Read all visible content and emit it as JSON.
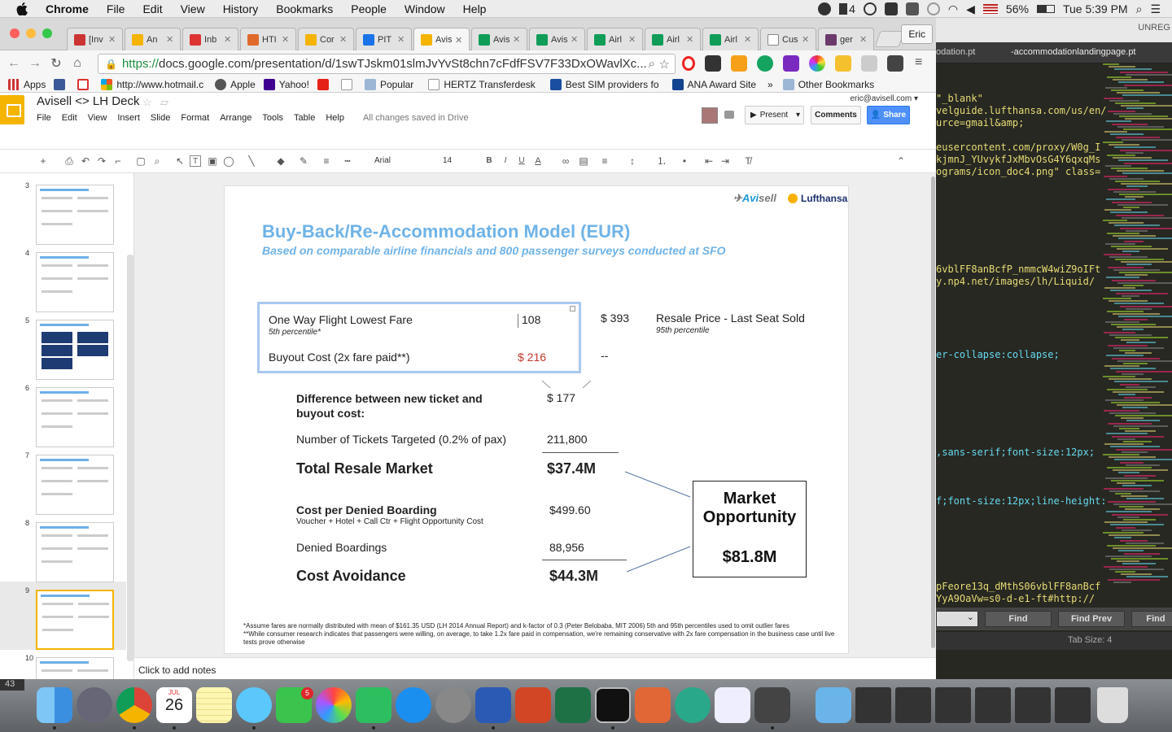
{
  "menubar": {
    "app": "Chrome",
    "items": [
      "File",
      "Edit",
      "View",
      "History",
      "Bookmarks",
      "People",
      "Window",
      "Help"
    ],
    "status_count": "4",
    "battery": "56%",
    "clock": "Tue 5:39 PM"
  },
  "browser": {
    "tabs": [
      "[Inv",
      "An",
      "Inb",
      "HTI",
      "Cor",
      "PIT",
      "Avis",
      "Avis",
      "Avis",
      "Airl",
      "Airl",
      "Airl",
      "Cus",
      "ger"
    ],
    "active_tab": 6,
    "profile": "Eric",
    "url_scheme": "https://",
    "url_rest": "docs.google.com/presentation/d/1swTJskm01slmJvYvSt8chn7cFdfFSV7F33DxOWavlXc...",
    "bookmarks": [
      "Apps",
      "http://www.hotmail.c",
      "Apple",
      "Yahoo!",
      "Popular",
      "HERTZ Transferdesk",
      "Best SIM providers fo",
      "ANA Award Site",
      "»",
      "Other Bookmarks"
    ]
  },
  "docs": {
    "title": "Avisell <> LH Deck",
    "menus": [
      "File",
      "Edit",
      "View",
      "Insert",
      "Slide",
      "Format",
      "Arrange",
      "Tools",
      "Table",
      "Help"
    ],
    "saved_status": "All changes saved in Drive",
    "email": "eric@avisell.com ▾",
    "present": "Present",
    "comments": "Comments",
    "share": "Share",
    "font": "Arial",
    "font_size": "14",
    "notes_placeholder": "Click to add notes"
  },
  "filmstrip": {
    "numbers": [
      "3",
      "4",
      "5",
      "6",
      "7",
      "8",
      "9",
      "10"
    ],
    "selected": "9"
  },
  "slide": {
    "logo_avisell_a": "Avi",
    "logo_avisell_b": "sell",
    "logo_lufthansa": "Lufthansa",
    "title": "Buy-Back/Re-Accommodation Model (EUR)",
    "subtitle": "Based on comparable airline financials and 800 passenger surveys conducted at SFO",
    "fare_label": "One Way Flight Lowest Fare",
    "fare_sub": "5th percentile*",
    "fare_value": "108",
    "buyout_label": "Buyout Cost (2x fare paid**)",
    "buyout_value": "$ 216",
    "resale_value": "$ 393",
    "resale_label": "Resale Price - Last Seat Sold",
    "resale_sub": "95th percentile",
    "dash": "--",
    "diff_label": "Difference between new ticket and buyout cost:",
    "diff_value": "$ 177",
    "tickets_label": "Number of Tickets Targeted (0.2% of pax)",
    "tickets_value": "211,800",
    "total_label": "Total Resale Market",
    "total_value": "$37.4M",
    "cpdb_label": "Cost per Denied Boarding",
    "cpdb_sub": "Voucher + Hotel + Call Ctr + Flight Opportunity Cost",
    "cpdb_value": "$499.60",
    "denied_label": "Denied Boardings",
    "denied_value": "88,956",
    "avoid_label": "Cost Avoidance",
    "avoid_value": "$44.3M",
    "market_line1": "Market",
    "market_line2": "Opportunity",
    "market_value": "$81.8M",
    "footnote1": "*Assume fares are normally distributed with mean of $161.35 USD (LH 2014 Annual Report) and k-factor of 0.3 (Peter Belobaba, MIT 2006) 5th and 95th percentiles used to omit outlier fares",
    "footnote2": "**While consumer research indicates that passengers were willing, on average, to take 1.2x fare paid in compensation, we're remaining conservative with 2x fare compensation in the business case until live tests prove otherwise"
  },
  "editor": {
    "header": "UNREG",
    "tab1": "odation.pt",
    "tab2": "-accommodationlandingpage.pt",
    "lines": [
      {
        "t": "\"_blank\"",
        "c": "#e6db74"
      },
      {
        "t": "velguide.lufthansa.com/us/en/",
        "c": "#e6db74"
      },
      {
        "t": "urce=gmail&amp;",
        "c": "#e6db74"
      },
      {
        "t": "",
        "c": "#f8f8f2"
      },
      {
        "t": "eusercontent.com/proxy/W0g_I",
        "c": "#e6db74"
      },
      {
        "t": "kjmnJ_YUvykfJxMbvOsG4Y6qxqMs",
        "c": "#e6db74"
      },
      {
        "t": "ograms/icon_doc4.png\" class=",
        "c": "#e6db74"
      },
      {
        "t": "6vblFF8anBcfP_nmmcW4wiZ9oIFt",
        "c": "#e6db74"
      },
      {
        "t": "y.np4.net/images/lh/Liquid/",
        "c": "#e6db74"
      },
      {
        "t": "er-collapse:collapse;",
        "c": "#66d9ef"
      },
      {
        "t": ",sans-serif;font-size:12px;",
        "c": "#66d9ef"
      },
      {
        "t": "f;font-size:12px;line-height:",
        "c": "#66d9ef"
      },
      {
        "t": "pFeore13q_dMthS06vblFF8anBcf",
        "c": "#e6db74"
      },
      {
        "t": "YyA9OaVw=s0-d-e1-ft#http://",
        "c": "#e6db74"
      }
    ],
    "find": "Find",
    "find_prev": "Find Prev",
    "find_all": "Find",
    "tab_size": "Tab Size: 4",
    "line_count": "43"
  },
  "dock": {
    "calendar_month": "JUL",
    "calendar_day": "26",
    "facetime_badge": "5"
  }
}
